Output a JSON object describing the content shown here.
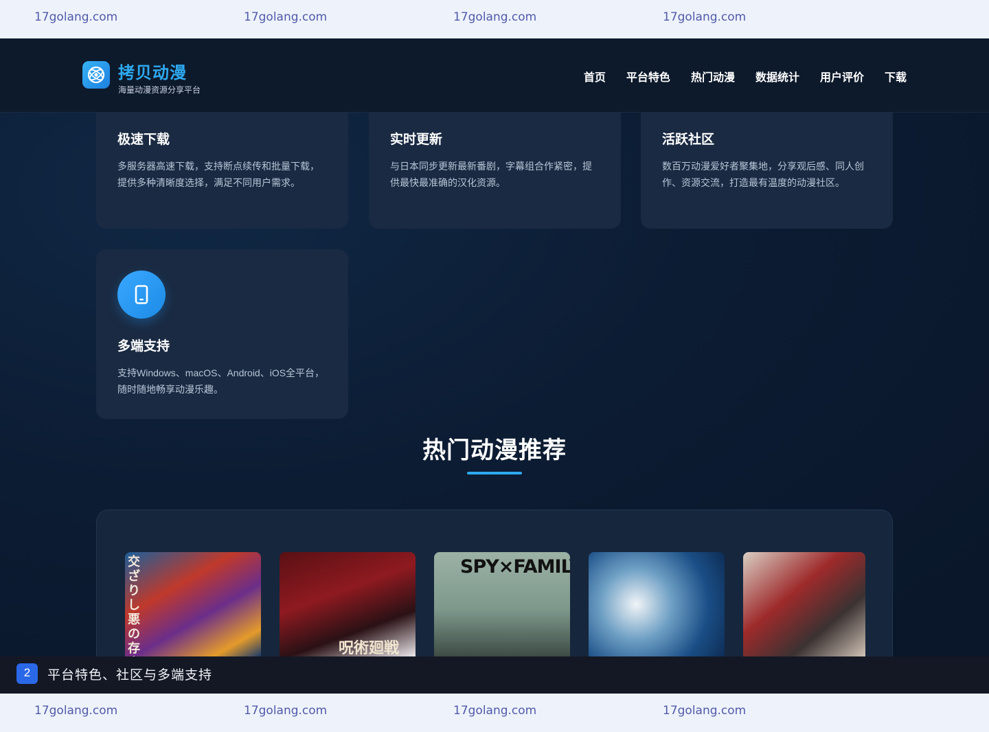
{
  "watermark": {
    "text": "17golang.com"
  },
  "header": {
    "brand_name": "拷贝动漫",
    "brand_sub": "海量动漫资源分享平台",
    "nav": [
      "首页",
      "平台特色",
      "热门动漫",
      "数据统计",
      "用户评价",
      "下载"
    ]
  },
  "features": [
    {
      "title": "极速下载",
      "desc": "多服务器高速下载，支持断点续传和批量下载，提供多种清晰度选择，满足不同用户需求。"
    },
    {
      "title": "实时更新",
      "desc": "与日本同步更新最新番剧，字幕组合作紧密，提供最快最准确的汉化资源。"
    },
    {
      "title": "活跃社区",
      "desc": "数百万动漫爱好者聚集地，分享观后感、同人创作、资源交流，打造最有温度的动漫社区。"
    },
    {
      "title": "多端支持",
      "desc": "支持Windows、macOS、Android、iOS全平台，随时随地畅享动漫乐趣。",
      "icon": "mobile-icon"
    }
  ],
  "hot_section": {
    "title": "热门动漫推荐",
    "posters": [
      {
        "caption": "交ざりし悪の存意"
      },
      {
        "caption": "呪術廻戦"
      },
      {
        "caption": "SPY×FAMILY"
      },
      {
        "caption": ""
      },
      {
        "caption": ""
      }
    ]
  },
  "status_bar": {
    "number": "2",
    "text": "平台特色、社区与多端支持"
  },
  "colors": {
    "accent": "#2ea9ef",
    "card": "#1a2a42",
    "badge": "#2b68e8"
  }
}
